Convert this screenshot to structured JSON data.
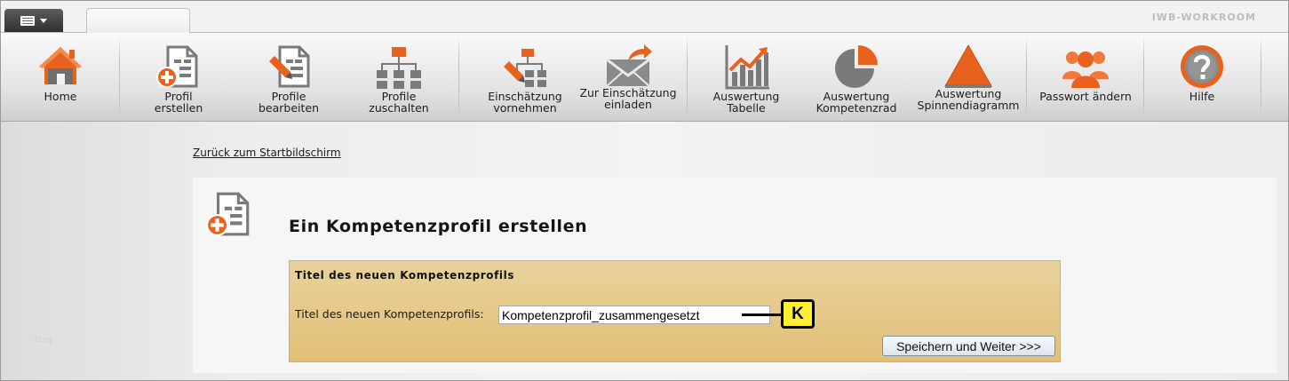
{
  "brand": "IWB-WORKROOM",
  "toolbar": {
    "items": [
      {
        "label1": "Home",
        "label2": "",
        "icon": "home-icon"
      },
      {
        "label1": "Profil",
        "label2": "erstellen",
        "icon": "profile-add-icon"
      },
      {
        "label1": "Profile",
        "label2": "bearbeiten",
        "icon": "profile-edit-icon"
      },
      {
        "label1": "Profile",
        "label2": "zuschalten",
        "icon": "hierarchy-icon"
      },
      {
        "label1": "Einschätzung",
        "label2": "vornehmen",
        "icon": "assessment-icon"
      },
      {
        "label1": "Zur Einschätzung",
        "label2": "einladen",
        "icon": "invite-mail-icon"
      },
      {
        "label1": "Auswertung",
        "label2": "Tabelle",
        "icon": "chart-table-icon"
      },
      {
        "label1": "Auswertung",
        "label2": "Kompetenzrad",
        "icon": "pie-chart-icon"
      },
      {
        "label1": "Auswertung",
        "label2": "Spinnendiagramm",
        "icon": "triangle-chart-icon"
      },
      {
        "label1": "Passwort ändern",
        "label2": "",
        "icon": "users-icon"
      },
      {
        "label1": "Hilfe",
        "label2": "",
        "icon": "help-icon"
      }
    ]
  },
  "back_link": "Zurück zum Startbildschirm",
  "page_title": "Ein Kompetenzprofil erstellen",
  "form": {
    "section_title": "Titel des neuen Kompetenzprofils",
    "field_label": "Titel des neuen Kompetenzprofils:",
    "field_value": "Kompetenzprofil_zusammengesetzt",
    "marker": "K",
    "save_label": "Speichern und Weiter >>>"
  },
  "footer_text": "blog",
  "colors": {
    "accent_orange": "#e8621e",
    "icon_gray": "#7a7a7a",
    "form_bg": "#e3c67f",
    "marker_yellow": "#ffef33"
  }
}
